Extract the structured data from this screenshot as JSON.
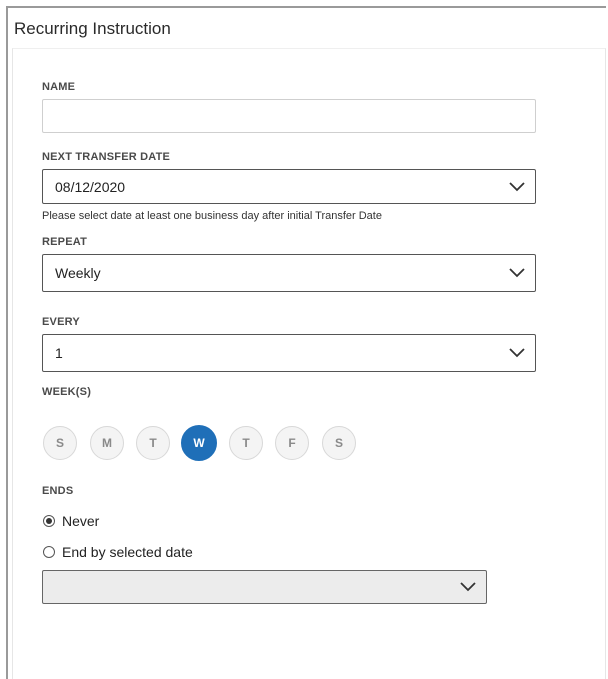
{
  "dialog": {
    "title": "Recurring Instruction"
  },
  "form": {
    "name": {
      "label": "NAME",
      "value": "",
      "placeholder": ""
    },
    "next_transfer_date": {
      "label": "NEXT TRANSFER DATE",
      "value": "08/12/2020",
      "hint": "Please select date at least one business day after initial Transfer Date"
    },
    "repeat": {
      "label": "REPEAT",
      "value": "Weekly"
    },
    "every": {
      "label": "EVERY",
      "value": "1"
    },
    "weeks": {
      "label": "WEEK(S)",
      "days": [
        "S",
        "M",
        "T",
        "W",
        "T",
        "F",
        "S"
      ],
      "selected_index": 3
    },
    "ends": {
      "label": "ENDS",
      "options": [
        "Never",
        "End by selected date"
      ],
      "selected_index": 0,
      "end_date_value": ""
    }
  },
  "colors": {
    "accent": "#1f6fb8",
    "disabled_bg": "#ececec"
  },
  "icons": {
    "dropdown": "chevron-down-icon"
  }
}
